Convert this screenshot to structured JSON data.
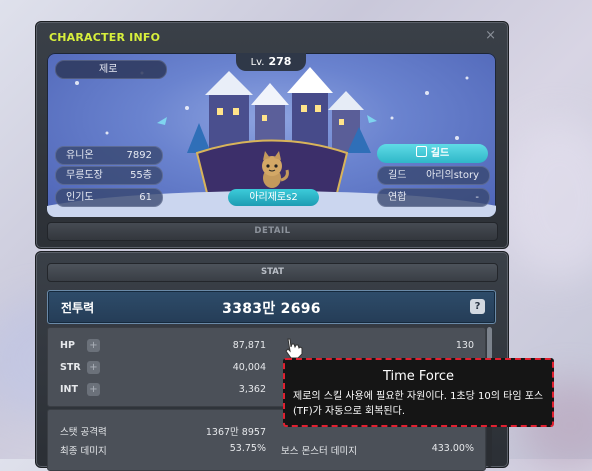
{
  "window": {
    "title": "CHARACTER INFO",
    "close_glyph": "×"
  },
  "character": {
    "job_label": "제로",
    "level_prefix": "Lv.",
    "level": "278",
    "name": "아리제로s2",
    "stats_left": [
      {
        "key": "유니온",
        "value": "7892"
      },
      {
        "key": "무릉도장",
        "value": "55층"
      },
      {
        "key": "인기도",
        "value": "61"
      }
    ],
    "guild_button": "길드",
    "stats_right": [
      {
        "key": "길드",
        "value": "아리의story"
      },
      {
        "key": "연합",
        "value": "-"
      }
    ]
  },
  "detail_tab": "DETAIL",
  "stat_tab": "STAT",
  "power": {
    "label": "전투력",
    "value": "3383만 2696",
    "help": "?"
  },
  "stats": [
    {
      "key": "HP",
      "value": "87,871",
      "value2": "130"
    },
    {
      "key": "STR",
      "value": "40,004",
      "value2": ""
    },
    {
      "key": "INT",
      "value": "3,362",
      "value2": ""
    }
  ],
  "stats2": [
    {
      "key": "스탯 공격력",
      "value": "1367만 8957",
      "key2": "",
      "value2": ""
    },
    {
      "key": "최종 데미지",
      "value": "53.75%",
      "key2": "보스 몬스터 데미지",
      "value2": "433.00%"
    }
  ],
  "tooltip": {
    "title": "Time Force",
    "body": "제로의 스킬 사용에 필요한 자원이다. 1초당 10의 타임 포스(TF)가 자동으로 회복된다."
  }
}
